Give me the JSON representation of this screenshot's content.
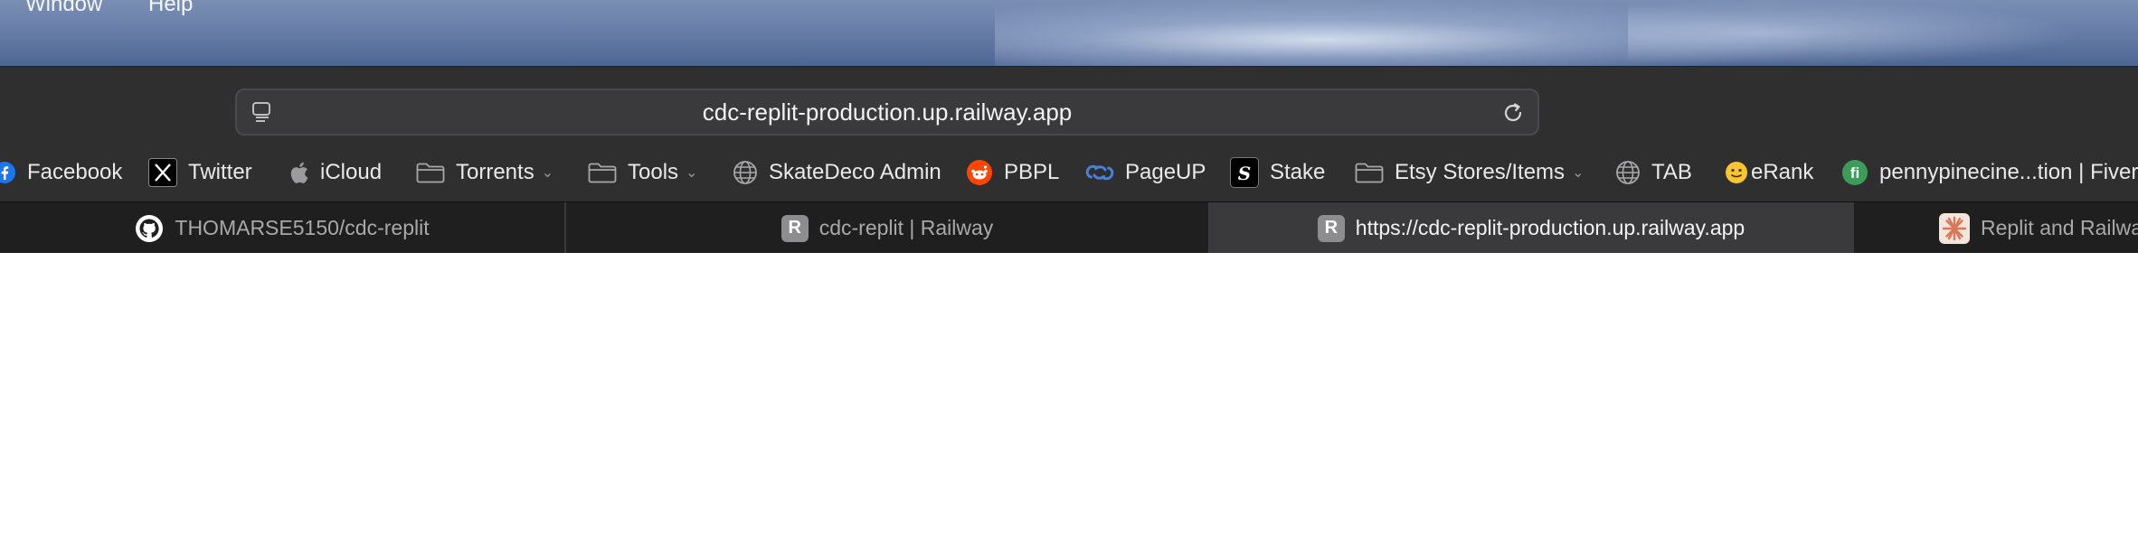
{
  "menubar": {
    "items": [
      "Window",
      "Help"
    ]
  },
  "address_bar": {
    "url": "cdc-replit-production.up.railway.app"
  },
  "bookmarks": [
    {
      "label": "Facebook",
      "icon": "facebook-icon"
    },
    {
      "label": "Twitter",
      "icon": "x-icon"
    },
    {
      "label": "iCloud",
      "icon": "apple-icon"
    },
    {
      "label": "Torrents",
      "icon": "folder-icon"
    },
    {
      "label": "Tools",
      "icon": "folder-icon"
    },
    {
      "label": "SkateDeco Admin",
      "icon": "globe-icon"
    },
    {
      "label": "PBPL",
      "icon": "reddit-icon"
    },
    {
      "label": "PageUP",
      "icon": "link-icon"
    },
    {
      "label": "Stake",
      "icon": "stake-icon"
    },
    {
      "label": "Etsy Stores/Items",
      "icon": "folder-icon"
    },
    {
      "label": "TAB",
      "icon": "globe-icon"
    },
    {
      "label": "eRank",
      "icon": "smiley-icon"
    },
    {
      "label": "pennypinecine...tion | Fiverr",
      "icon": "fiverr-icon"
    }
  ],
  "tabs": [
    {
      "label": "THOMARSE5150/cdc-replit",
      "icon": "github-icon",
      "active": false
    },
    {
      "label": "cdc-replit | Railway",
      "icon": "railway-icon",
      "active": false
    },
    {
      "label": "https://cdc-replit-production.up.railway.app",
      "icon": "railway-icon",
      "active": true
    },
    {
      "label": "Replit and Railwa",
      "icon": "claude-icon",
      "active": false
    }
  ],
  "colors": {
    "toolbar_bg": "#2f2f30",
    "tabbar_bg": "#1f1f20",
    "active_tab_bg": "#3a3a3c",
    "content_bg": "#ffffff"
  }
}
